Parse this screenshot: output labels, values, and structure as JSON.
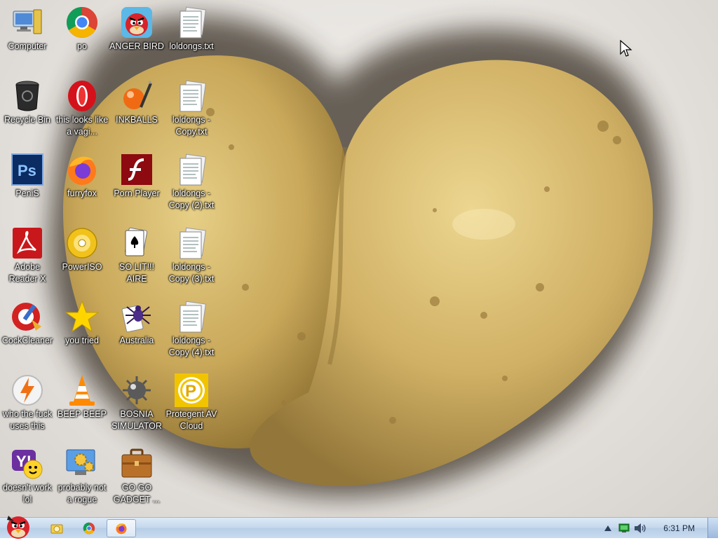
{
  "desktop": {
    "icons": [
      {
        "label": "Computer"
      },
      {
        "label": "po"
      },
      {
        "label": "ANGER BIRD"
      },
      {
        "label": "loldongs.txt"
      },
      {
        "label": "Recycle Bin"
      },
      {
        "label": "this looks like a vagi..."
      },
      {
        "label": "INKBALLS"
      },
      {
        "label": "loldongs - Copy.txt"
      },
      {
        "label": "PeniS"
      },
      {
        "label": "furryfox"
      },
      {
        "label": "Porn Player"
      },
      {
        "label": "loldongs - Copy (2).txt"
      },
      {
        "label": "Adobe Reader X"
      },
      {
        "label": "PowerISO"
      },
      {
        "label": "SO LIT!!! AIRE"
      },
      {
        "label": "loldongs - Copy (3).txt"
      },
      {
        "label": "CockCleaner"
      },
      {
        "label": "you tried"
      },
      {
        "label": "Australia"
      },
      {
        "label": "loldongs - Copy (4).txt"
      },
      {
        "label": "who the fuck uses this"
      },
      {
        "label": "BEEP BEEP"
      },
      {
        "label": "BOSNIA SIMULATOR"
      },
      {
        "label": "Protegent AV Cloud"
      },
      {
        "label": "doesn't work lol"
      },
      {
        "label": "probably not a rogue"
      },
      {
        "label": "GO GO GADGET ..."
      }
    ]
  },
  "taskbar": {
    "clock": "6:31 PM",
    "items": [
      "start-orb",
      "explorer",
      "chrome",
      "firefox"
    ],
    "tray": [
      "show-hidden-icons",
      "network",
      "volume"
    ]
  }
}
